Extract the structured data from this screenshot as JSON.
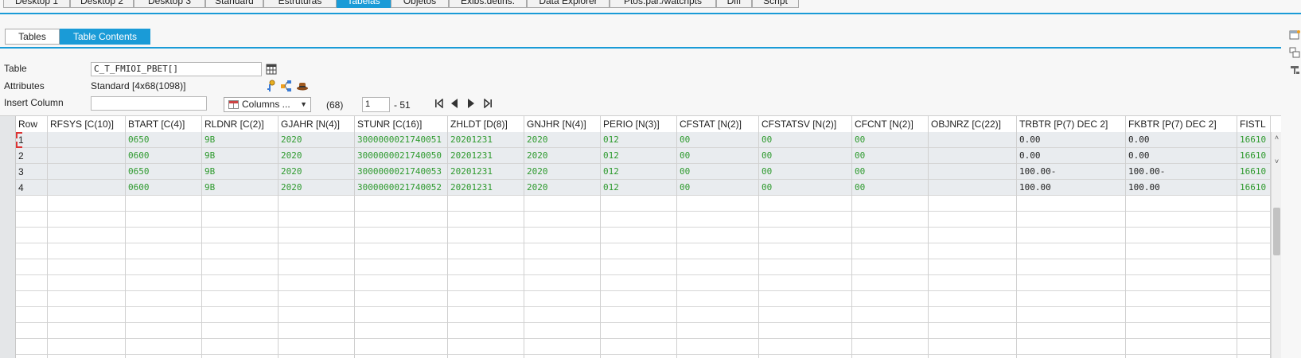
{
  "top_tabs": [
    {
      "label": "Desktop 1"
    },
    {
      "label": "Desktop 2"
    },
    {
      "label": "Desktop 3"
    },
    {
      "label": "Standard"
    },
    {
      "label": "Estruturas"
    },
    {
      "label": "Tabelas",
      "active": true
    },
    {
      "label": "Objetos"
    },
    {
      "label": "Exibs.detins."
    },
    {
      "label": "Data Explorer"
    },
    {
      "label": "Ptos.par./watchpts"
    },
    {
      "label": "Diff"
    },
    {
      "label": "Script"
    }
  ],
  "sub_tabs": [
    {
      "label": "Tables"
    },
    {
      "label": "Table Contents",
      "active": true
    }
  ],
  "form": {
    "table_label": "Table",
    "table_value": "C_T_FMIOI_PBET[]",
    "attributes_label": "Attributes",
    "attributes_value": "Standard [4x68(1098)]",
    "insert_column_label": "Insert Column",
    "insert_column_value": "",
    "columns_button": "Columns ...",
    "total_columns": "(68)",
    "page_from": "1",
    "page_to": "- 51"
  },
  "grid": {
    "columns": [
      "Row",
      "RFSYS [C(10)]",
      "BTART [C(4)]",
      "RLDNR [C(2)]",
      "GJAHR [N(4)]",
      "STUNR [C(16)]",
      "ZHLDT [D(8)]",
      "GNJHR [N(4)]",
      "PERIO [N(3)]",
      "CFSTAT [N(2)]",
      "CFSTATSV [N(2)]",
      "CFCNT [N(2)]",
      "OBJNRZ [C(22)]",
      "TRBTR [P(7) DEC 2]",
      "FKBTR [P(7) DEC 2]",
      "FISTL"
    ],
    "rows": [
      [
        "1",
        "",
        "0650",
        "9B",
        "2020",
        "3000000021740051",
        "20201231",
        "2020",
        "012",
        "00",
        "00",
        "00",
        "",
        "0.00",
        "0.00",
        "16610"
      ],
      [
        "2",
        "",
        "0600",
        "9B",
        "2020",
        "3000000021740050",
        "20201231",
        "2020",
        "012",
        "00",
        "00",
        "00",
        "",
        "0.00",
        "0.00",
        "16610"
      ],
      [
        "3",
        "",
        "0650",
        "9B",
        "2020",
        "3000000021740053",
        "20201231",
        "2020",
        "012",
        "00",
        "00",
        "00",
        "",
        "100.00-",
        "100.00-",
        "16610"
      ],
      [
        "4",
        "",
        "0600",
        "9B",
        "2020",
        "3000000021740052",
        "20201231",
        "2020",
        "012",
        "00",
        "00",
        "00",
        "",
        "100.00",
        "100.00",
        "16610"
      ]
    ],
    "green_columns": [
      2,
      3,
      4,
      5,
      6,
      7,
      8,
      9,
      10,
      11,
      15
    ]
  },
  "icons": {
    "table_picker": "table-picker-icon",
    "attr_icons": [
      "key-icon",
      "structure-icon",
      "hat-icon"
    ],
    "nav": [
      "first-page-icon",
      "prev-page-icon",
      "next-page-icon",
      "last-page-icon"
    ],
    "side": [
      "window-icon",
      "layout-icon",
      "settings-icon"
    ]
  },
  "colors": {
    "accent": "#1a9bd7",
    "green_text": "#2e9a2e",
    "row_fill": "#e9ecef"
  }
}
